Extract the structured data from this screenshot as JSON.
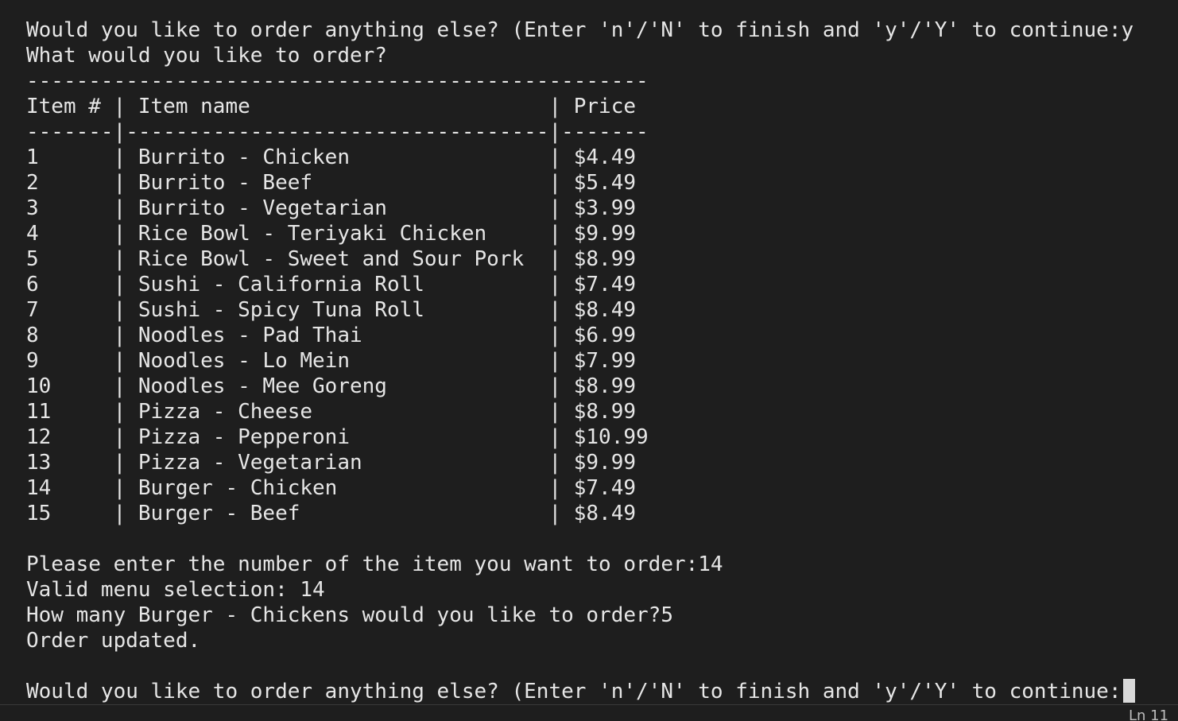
{
  "terminal": {
    "lines": [
      "Would you like to order anything else? (Enter 'n'/'N' to finish and 'y'/'Y' to continue:y",
      "What would you like to order?",
      "--------------------------------------------------",
      "Item # | Item name                        | Price",
      "-------|----------------------------------|-------",
      "1      | Burrito - Chicken                | $4.49",
      "2      | Burrito - Beef                   | $5.49",
      "3      | Burrito - Vegetarian             | $3.99",
      "4      | Rice Bowl - Teriyaki Chicken     | $9.99",
      "5      | Rice Bowl - Sweet and Sour Pork  | $8.99",
      "6      | Sushi - California Roll          | $7.49",
      "7      | Sushi - Spicy Tuna Roll          | $8.49",
      "8      | Noodles - Pad Thai               | $6.99",
      "9      | Noodles - Lo Mein                | $7.99",
      "10     | Noodles - Mee Goreng             | $8.99",
      "11     | Pizza - Cheese                   | $8.99",
      "12     | Pizza - Pepperoni                | $10.99",
      "13     | Pizza - Vegetarian               | $9.99",
      "14     | Burger - Chicken                 | $7.49",
      "15     | Burger - Beef                    | $8.49",
      "",
      "Please enter the number of the item you want to order:14",
      "Valid menu selection: 14",
      "How many Burger - Chickens would you like to order?5",
      "Order updated.",
      "",
      "Would you like to order anything else? (Enter 'n'/'N' to finish and 'y'/'Y' to continue:"
    ]
  },
  "status_bar": {
    "fragment": "Ln 11"
  },
  "colors": {
    "background": "#1e1e1e",
    "text": "#e6e6e6",
    "cursor": "#d9d9d9"
  }
}
